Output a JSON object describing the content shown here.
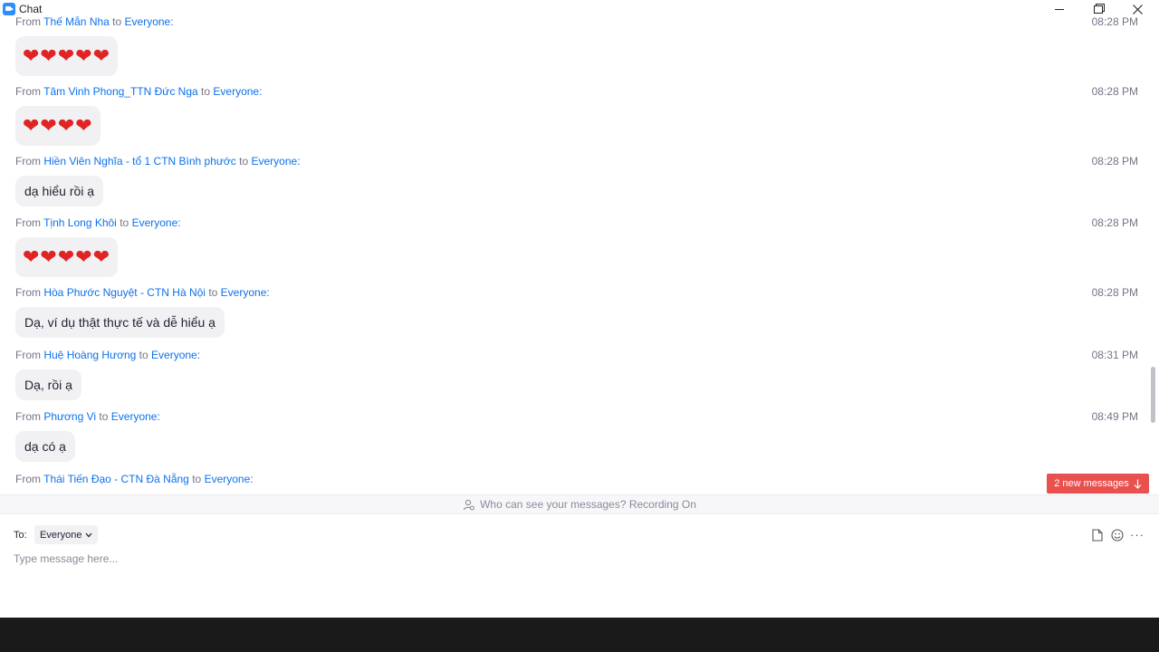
{
  "window": {
    "title": "Chat"
  },
  "messages": [
    {
      "prefix": "From",
      "sender": "Thế Mẫn Nha",
      "to_word": "to",
      "recipient": "Everyone:",
      "time": "08:28 PM",
      "text": "❤❤❤❤❤",
      "emoji": true
    },
    {
      "prefix": "From",
      "sender": "Tâm Vinh Phong_TTN Đức Nga",
      "to_word": "to",
      "recipient": "Everyone:",
      "time": "08:28 PM",
      "text": "❤❤❤❤",
      "emoji": true
    },
    {
      "prefix": "From",
      "sender": "Hiền Viên Nghĩa - tổ 1 CTN Bình phước",
      "to_word": "to",
      "recipient": "Everyone:",
      "time": "08:28 PM",
      "text": "dạ hiểu rồi ạ",
      "emoji": false
    },
    {
      "prefix": "From",
      "sender": "Tịnh Long Khôi",
      "to_word": "to",
      "recipient": "Everyone:",
      "time": "08:28 PM",
      "text": "❤❤❤❤❤",
      "emoji": true
    },
    {
      "prefix": "From",
      "sender": "Hòa Phước Nguyệt - CTN Hà Nội",
      "to_word": "to",
      "recipient": "Everyone:",
      "time": "08:28 PM",
      "text": "Dạ, ví dụ thật thực tế và dễ hiểu ạ",
      "emoji": false
    },
    {
      "prefix": "From",
      "sender": "Huệ Hoàng Hương",
      "to_word": "to",
      "recipient": "Everyone:",
      "time": "08:31 PM",
      "text": "Dạ, rồi ạ",
      "emoji": false
    },
    {
      "prefix": "From",
      "sender": "Phương Vi",
      "to_word": "to",
      "recipient": "Everyone:",
      "time": "08:49 PM",
      "text": "dạ có ạ",
      "emoji": false
    },
    {
      "prefix": "From",
      "sender": "Thái Tiến Đạo - CTN Đà Nẵng",
      "to_word": "to",
      "recipient": "Everyone:",
      "time": "",
      "text": "",
      "emoji": false
    }
  ],
  "new_messages": {
    "label": "2 new messages"
  },
  "privacy": {
    "text": "Who can see your messages? Recording On"
  },
  "composer": {
    "to_label": "To:",
    "recipient": "Everyone",
    "placeholder": "Type message here...",
    "more_label": "···"
  },
  "colors": {
    "link": "#0e71eb",
    "alert": "#e8514e",
    "heart": "#e02424"
  },
  "icons": [
    "zoom-app-icon",
    "minimize-icon",
    "restore-icon",
    "close-icon",
    "arrow-down-icon",
    "person-icon",
    "chevron-down-icon",
    "file-icon",
    "emoji-icon",
    "more-icon"
  ]
}
